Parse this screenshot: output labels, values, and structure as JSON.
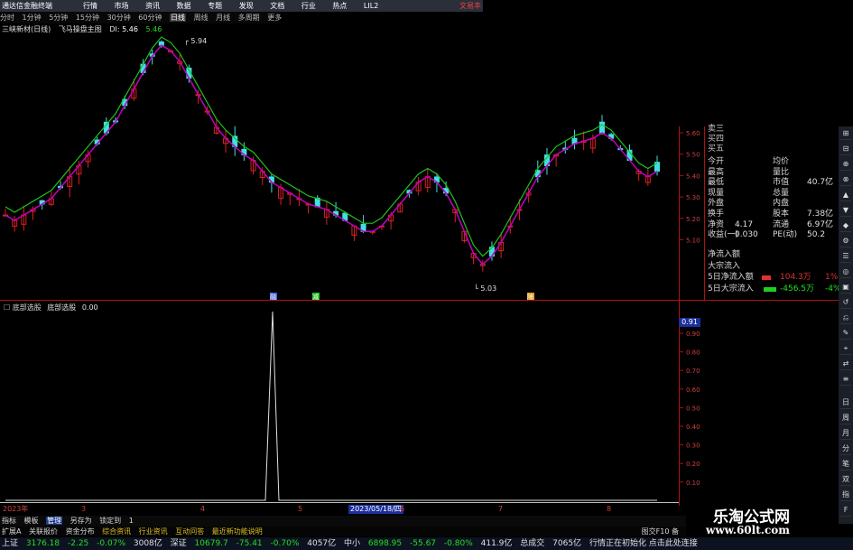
{
  "app": {
    "title": "通达信金融终端",
    "menu": [
      "行情",
      "市场",
      "资讯",
      "数据",
      "专题",
      "发现",
      "文档",
      "行业",
      "热点",
      "LIL2"
    ],
    "account_label": "文易丰"
  },
  "periods": [
    "分时",
    "1分钟",
    "5分钟",
    "15分钟",
    "30分钟",
    "60分钟",
    "日线",
    "周线",
    "月线",
    "多周期",
    "更多"
  ],
  "period_selected": "日线",
  "price_chart": {
    "title": "三峡新材(日线)",
    "indicator_name": "飞马操盘主图",
    "readout_label": "DI:",
    "readout_value": "5.46",
    "readout_value2": "5.46",
    "high_label": "5.94",
    "low_label": "5.03",
    "price_ticks": [
      "5.60",
      "5.50",
      "5.40",
      "5.30",
      "5.20",
      "5.10"
    ],
    "up_color": "#dd2020",
    "down_color": "#40e0e0",
    "ma_line_color": "#c000c0",
    "band_line_color": "#20c020",
    "date_markers": [
      "融",
      "减",
      "除"
    ],
    "chart_data": {
      "type": "candlestick",
      "title": "三峡新材(日线)",
      "y_range": [
        5.03,
        5.94
      ],
      "high": 5.94,
      "low": 5.03
    }
  },
  "quote_panel": {
    "sell": [
      "卖三",
      "买四",
      "买五"
    ],
    "rows": [
      {
        "l1": "今开",
        "v1": "",
        "l2": "均价",
        "v2": ""
      },
      {
        "l1": "最高",
        "v1": "",
        "l2": "量比",
        "v2": ""
      },
      {
        "l1": "最低",
        "v1": "",
        "l2": "市值",
        "v2": "40.7亿"
      },
      {
        "l1": "现量",
        "v1": "",
        "l2": "总量",
        "v2": ""
      },
      {
        "l1": "外盘",
        "v1": "",
        "l2": "内盘",
        "v2": ""
      },
      {
        "l1": "换手",
        "v1": "",
        "l2": "股本",
        "v2": "7.38亿"
      },
      {
        "l1": "净资",
        "v1": "4.17",
        "l2": "流通",
        "v2": "6.97亿"
      },
      {
        "l1": "收益(一)",
        "v1": "0.030",
        "l2": "PE(动)",
        "v2": "50.2"
      }
    ],
    "flow": [
      {
        "label": "净流入额",
        "value": "",
        "pct": ""
      },
      {
        "label": "大宗流入",
        "value": "",
        "pct": ""
      },
      {
        "label": "5日净流入额",
        "value": "104.3万",
        "pct": "1%"
      },
      {
        "label": "5日大宗流入",
        "value": "-456.5万",
        "pct": "-4%"
      }
    ]
  },
  "lower_chart": {
    "indicator_label": "底部选股",
    "indicator_name": "底部选股",
    "value": "0.00",
    "current_tag": "0.91",
    "ticks": [
      "0.90",
      "0.80",
      "0.70",
      "0.60",
      "0.50",
      "0.40",
      "0.30",
      "0.20",
      "0.10"
    ],
    "date_tag": "2023/05/18/四",
    "year_label": "2023年",
    "month_labels": [
      "3",
      "4",
      "5",
      "6",
      "7",
      "8"
    ],
    "line_color": "#e0e0e0",
    "chart_data": {
      "type": "line",
      "title": "底部选股",
      "y_range": [
        0,
        1
      ],
      "note_series_peak": 1
    }
  },
  "bottom_tabs": [
    "指标",
    "模板",
    "管理",
    "另存为",
    "锁定到",
    "1"
  ],
  "bottom_tab_active": "管理",
  "news_items": [
    "扩展A",
    "关联报价",
    "资金分布",
    "综合资讯",
    "行业资讯",
    "互动问答",
    "最近新功能说明"
  ],
  "news_right": "图交F10 备",
  "status": {
    "sh_label": "上证",
    "sh_value": "3176.18",
    "sh_change": "-2.25",
    "sh_pct": "-0.07%",
    "sh_amount": "3008亿",
    "sz_label": "深证",
    "sz_value": "10679.7",
    "sz_change": "-75.41",
    "sz_pct": "-0.70%",
    "sz_amount": "4057亿",
    "zx_label": "中小",
    "zx_value": "6898.95",
    "zx_change": "-55.67",
    "zx_pct": "-0.80%",
    "zx_amount": "411.9亿",
    "vol_label": "总成交",
    "vol_value": "7065亿",
    "msg": "行情正在初始化 点击此处连接"
  },
  "sidebar_items": [
    "日",
    "周",
    "月",
    "分",
    "笔",
    "双",
    "指",
    "F"
  ],
  "watermark": {
    "line1": "乐淘公式网",
    "line2": "www.60lt.com"
  }
}
